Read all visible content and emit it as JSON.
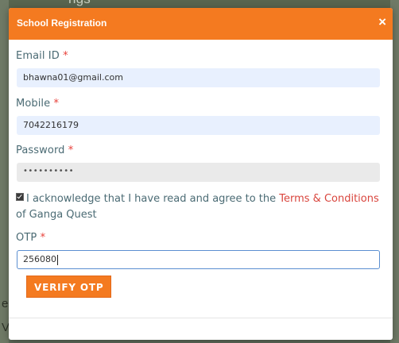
{
  "background": {
    "top_text": "ngs",
    "left_char_1": "e",
    "left_char_2": "V"
  },
  "modal": {
    "title": "School Registration",
    "close_glyph": "×",
    "accent_color": "#f47a20",
    "fields": {
      "email": {
        "label": "Email ID",
        "required_mark": "*",
        "value": "bhawna01@gmail.com"
      },
      "mobile": {
        "label": "Mobile",
        "required_mark": "*",
        "value": "7042216179"
      },
      "password": {
        "label": "Password",
        "required_mark": "*",
        "value": "••••••••••"
      },
      "otp": {
        "label": "OTP",
        "required_mark": "*",
        "value": "256080"
      }
    },
    "acknowledge": {
      "checked": true,
      "text_before": "I acknowledge that I have read and agree to the ",
      "link_text": "Terms & Conditions",
      "text_after": "of Ganga Quest"
    },
    "verify_button_label": "VERIFY OTP"
  }
}
